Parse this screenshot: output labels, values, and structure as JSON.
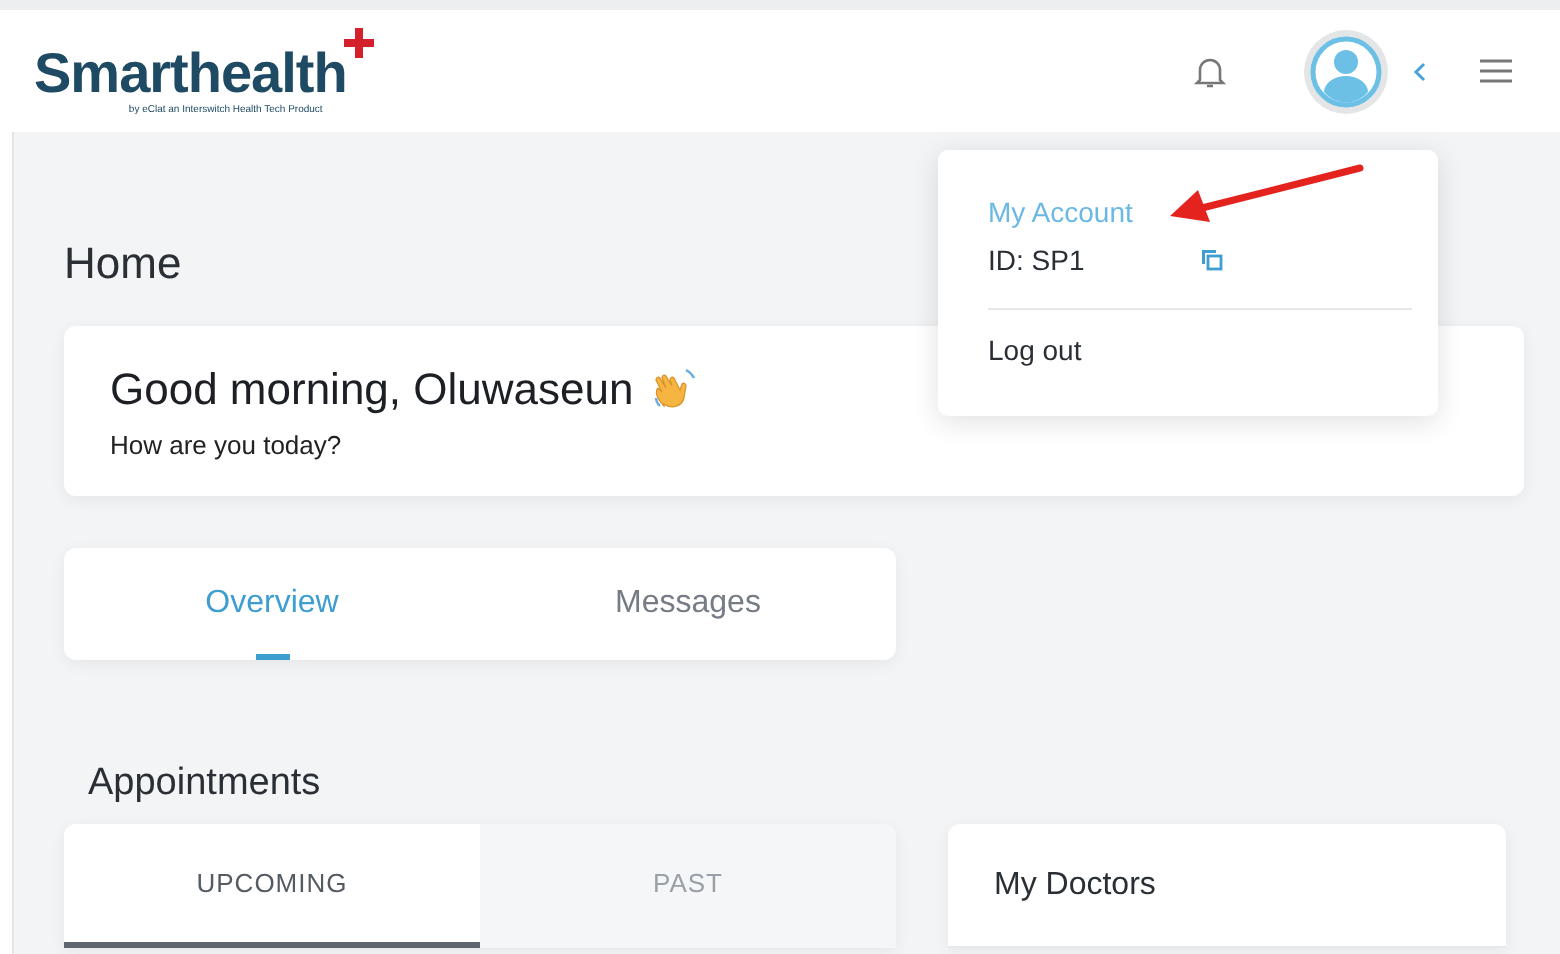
{
  "header": {
    "logo": "Smarthealth",
    "tagline": "by eClat an Interswitch Health Tech Product"
  },
  "account_menu": {
    "title": "My Account",
    "id_label": "ID: SP1",
    "items": [
      "Log out"
    ]
  },
  "page_title": "Home",
  "greeting": {
    "title": "Good morning, Oluwaseun",
    "subtitle": "How are you today?"
  },
  "tabs": [
    {
      "label": "Overview",
      "selected": true
    },
    {
      "label": "Messages",
      "selected": false
    }
  ],
  "appointments": {
    "title": "Appointments",
    "tabs": [
      {
        "label": "UPCOMING",
        "selected": true
      },
      {
        "label": "PAST",
        "selected": false
      }
    ]
  },
  "doctors": {
    "title": "My Doctors"
  }
}
